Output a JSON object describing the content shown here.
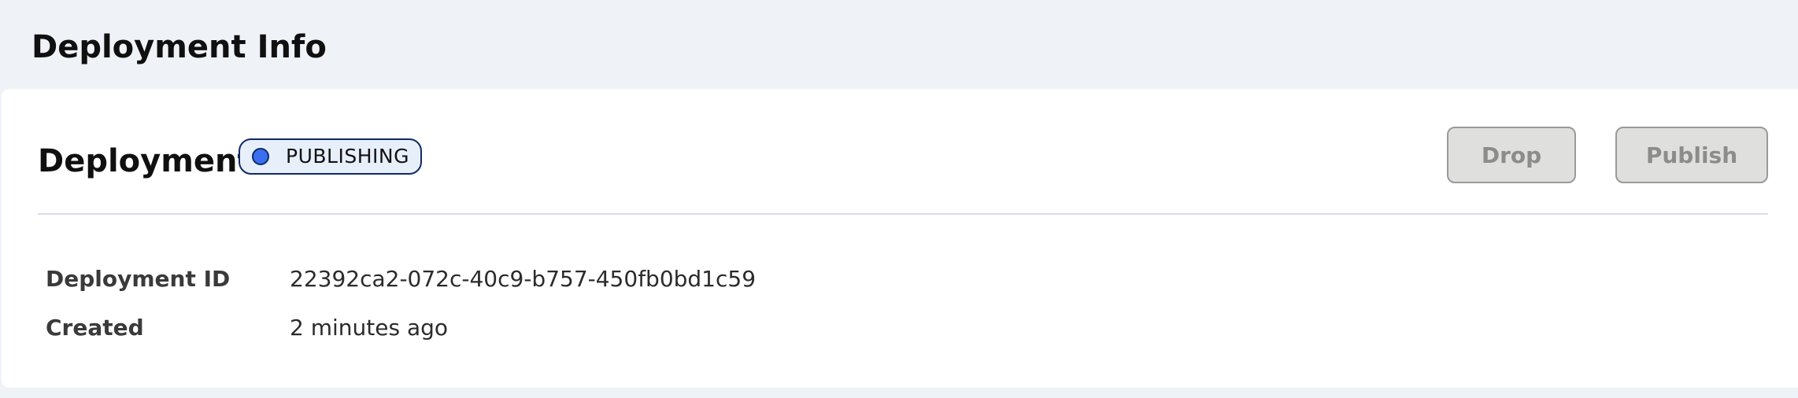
{
  "page": {
    "title": "Deployment Info"
  },
  "deployment": {
    "section_title": "Deployment",
    "status": {
      "label": "PUBLISHING",
      "dot_color": "#3b6ff0",
      "border_color": "#0f2a66",
      "background": "#e7effb"
    },
    "actions": {
      "drop_label": "Drop",
      "publish_label": "Publish",
      "disabled": true
    },
    "details": [
      {
        "label": "Deployment ID",
        "value": "22392ca2-072c-40c9-b757-450fb0bd1c59"
      },
      {
        "label": "Created",
        "value": "2 minutes ago"
      }
    ]
  }
}
